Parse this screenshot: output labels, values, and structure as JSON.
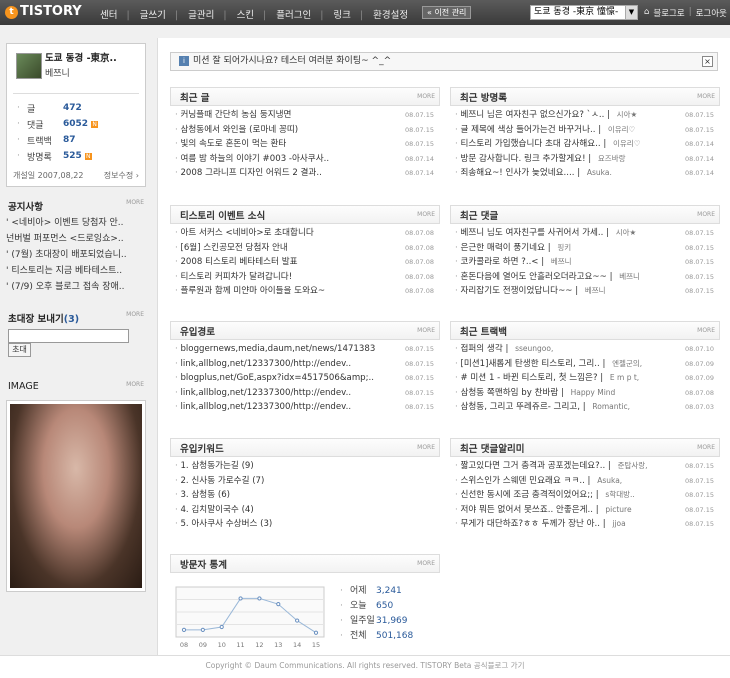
{
  "topbar": {
    "logo": "TISTORY",
    "logo_mark": "t",
    "menu": [
      "센터",
      "글쓰기",
      "글관리",
      "스킨",
      "플러그인",
      "링크",
      "환경설정"
    ],
    "old_admin": "« 이전 관리",
    "blog_select": "도쿄 동경 -東京 憧憬-",
    "links": [
      "블로그로",
      "로그아웃"
    ]
  },
  "profile": {
    "name": "도쿄 동경 -東京..",
    "subname": "베쯔니",
    "stats": [
      {
        "label": "글",
        "value": "472",
        "new": false
      },
      {
        "label": "댓글",
        "value": "6052",
        "new": true
      },
      {
        "label": "트랙백",
        "value": "87",
        "new": false
      },
      {
        "label": "방명록",
        "value": "525",
        "new": true
      }
    ],
    "opened": "개설일 2007,08,22",
    "info_edit": "정보수정"
  },
  "notice_section": {
    "title": "공지사항",
    "more": "MORE",
    "items": [
      "' <네비아> 이벤트 당첨자 안..",
      "넌버벌 퍼포먼스 <드로잉쇼>..",
      "' (7월) 초대장이 배포되었습니..",
      "' 티스토리는 지금 베타테스트..",
      "' (7/9) 오후 블로그 접속 장애.."
    ]
  },
  "invite": {
    "title": "초대장 보내기",
    "count": "(3)",
    "more": "MORE",
    "button": "초대"
  },
  "image_section": {
    "title": "IMAGE",
    "more": "MORE"
  },
  "notice_bar": {
    "text": "미션 잘 되어가시나요? 테스터 여러분 화이팅~ ^_^",
    "close": "×"
  },
  "panels": {
    "recent_posts": {
      "title": "최근 글",
      "more": "MORE",
      "rows": [
        {
          "t": "커닝플때 간단히 농심 둥지냉면",
          "d": "08.07.15"
        },
        {
          "t": "삼청동에서 와인을 (로마네 꽁띠)",
          "d": "08.07.15"
        },
        {
          "t": "빛의 속도로 혼돈이 먹는 환타",
          "d": "08.07.15"
        },
        {
          "t": "여름 밤 하늘의 이야기 #003 -아사쿠사..",
          "d": "08.07.14"
        },
        {
          "t": "2008 그라니프 디자인 어워드 2 결과..",
          "d": "08.07.14"
        }
      ]
    },
    "recent_guestbook": {
      "title": "최근 방명록",
      "more": "MORE",
      "rows": [
        {
          "t": "베쯔니 님은 여자친구 없으신가요? `ㅅ..",
          "a": "시아★",
          "d": "08.07.15"
        },
        {
          "t": "글 제목에 색상 들어가는건 바꾸거나..",
          "a": "이유리♡",
          "d": "08.07.15"
        },
        {
          "t": "티스토리 가입했습니다 초대 감사해요..",
          "a": "이유리♡",
          "d": "08.07.14"
        },
        {
          "t": "방문 감사합니다. 링크 추가할게요!",
          "a": "요즈바랑",
          "d": "08.07.14"
        },
        {
          "t": "죄송해요~! 인사가 늦었네요....",
          "a": "Asuka.",
          "d": "08.07.14"
        }
      ]
    },
    "tistory_events": {
      "title": "티스토리 이벤트 소식",
      "more": "MORE",
      "rows": [
        {
          "t": "아트 서커스 <네비아>로 초대합니다",
          "d": "08.07.08"
        },
        {
          "t": "[6월] 스킨공모전 당첨자 안내",
          "d": "08.07.08"
        },
        {
          "t": "2008 티스토리 베타테스터 발표",
          "d": "08.07.08"
        },
        {
          "t": "티스토리 커피차가 달려갑니다!",
          "d": "08.07.08"
        },
        {
          "t": "플루원과 함께 미얀마 아이들을 도와요~",
          "d": "08.07.08"
        }
      ]
    },
    "recent_comments": {
      "title": "최근 댓글",
      "more": "MORE",
      "rows": [
        {
          "t": "베쯔니 님도 여자친구를 사귀어서 가세..",
          "a": "시아★",
          "d": "08.07.15"
        },
        {
          "t": "은근한 매력이 풍기네요",
          "a": "핑키",
          "d": "08.07.15"
        },
        {
          "t": "코카콜라로 하면 ?..<",
          "a": "베쯔니",
          "d": "08.07.15"
        },
        {
          "t": "혼돈다음에 열어도 안흘러오더라고요~~",
          "a": "베쯔니",
          "d": "08.07.15"
        },
        {
          "t": "자리잡기도 전쟁이었답니다~~",
          "a": "베쯔니",
          "d": "08.07.15"
        }
      ]
    },
    "referrers": {
      "title": "유입경로",
      "more": "MORE",
      "rows": [
        {
          "t": "bloggernews,media,daum,net/news/1471383",
          "d": "08.07.15"
        },
        {
          "t": "link,allblog,net/12337300/http://endev..",
          "d": "08.07.15"
        },
        {
          "t": "blogplus,net/GoE,aspx?idx=4517506&amp;..",
          "d": "08.07.15"
        },
        {
          "t": "link,allblog,net/12337300/http://endev..",
          "d": "08.07.15"
        },
        {
          "t": "link,allblog,net/12337300/http://endev..",
          "d": "08.07.15"
        }
      ]
    },
    "recent_trackbacks": {
      "title": "최근 트랙백",
      "more": "MORE",
      "rows": [
        {
          "t": "접퍼의 생각",
          "a": "sseungoo,",
          "d": "08.07.10"
        },
        {
          "t": "[미션1]새롭게 탄생한 티스토리, 그리..",
          "a": "엔젤군의,",
          "d": "08.07.09"
        },
        {
          "t": "# 미션 1 - 바뀐 티스토리, 첫 느낌은?",
          "a": "E m p t,",
          "d": "08.07.09"
        },
        {
          "t": "삼청동 쪽맨하임 by 찬바람",
          "a": "Happy Mind",
          "d": "08.07.08"
        },
        {
          "t": "삼청동, 그리고 뚜레쥬르- 그리고,",
          "a": "Romantic,",
          "d": "08.07.03"
        }
      ]
    },
    "keywords": {
      "title": "유입키워드",
      "more": "MORE",
      "rows": [
        {
          "t": "1. 삼청동가는길 (9)"
        },
        {
          "t": "2. 신사동 가로수길 (7)"
        },
        {
          "t": "3. 삼청동 (6)"
        },
        {
          "t": "4. 김치말이국수 (4)"
        },
        {
          "t": "5. 아사쿠사 수상버스 (3)"
        }
      ]
    },
    "comment_notify": {
      "title": "최근 댓글알리미",
      "more": "MORE",
      "rows": [
        {
          "t": "짧고있다면 그거 충격과 공포겠는데요?..",
          "a": "준탑사랑,",
          "d": "08.07.15"
        },
        {
          "t": "스위스인가 스웨덴 민요래요 ㅋㅋ..",
          "a": "Asuka,",
          "d": "08.07.15"
        },
        {
          "t": "신선한 동시에 조금 충격적이었어요;;",
          "a": "s학대방..",
          "d": "08.07.15"
        },
        {
          "t": "저야 뭐든 없어서 못쓰죠.. 안좋은게..",
          "a": "picture",
          "d": "08.07.15"
        },
        {
          "t": "무게가 대단하죠?ㅎㅎ 두께가 장난 아..",
          "a": "jjoa",
          "d": "08.07.15"
        }
      ]
    },
    "visitors": {
      "title": "방문자 통계",
      "more": "MORE"
    }
  },
  "visitor_stats": [
    {
      "label": "어제",
      "value": "3,241"
    },
    {
      "label": "오늘",
      "value": "650"
    },
    {
      "label": "일주일",
      "value": "31,969"
    },
    {
      "label": "전체",
      "value": "501,168"
    }
  ],
  "chart_data": {
    "type": "line",
    "categories": [
      "08",
      "09",
      "10",
      "11",
      "12",
      "13",
      "14",
      "15"
    ],
    "values": [
      1.0,
      1.0,
      1.4,
      5.4,
      5.4,
      4.6,
      2.3,
      0.6
    ],
    "ylim": [
      0,
      7
    ],
    "grid": true
  },
  "footer": {
    "text": "Copyright © Daum Communications. All rights reserved. TISTORY Beta 공식블로그 가기"
  }
}
